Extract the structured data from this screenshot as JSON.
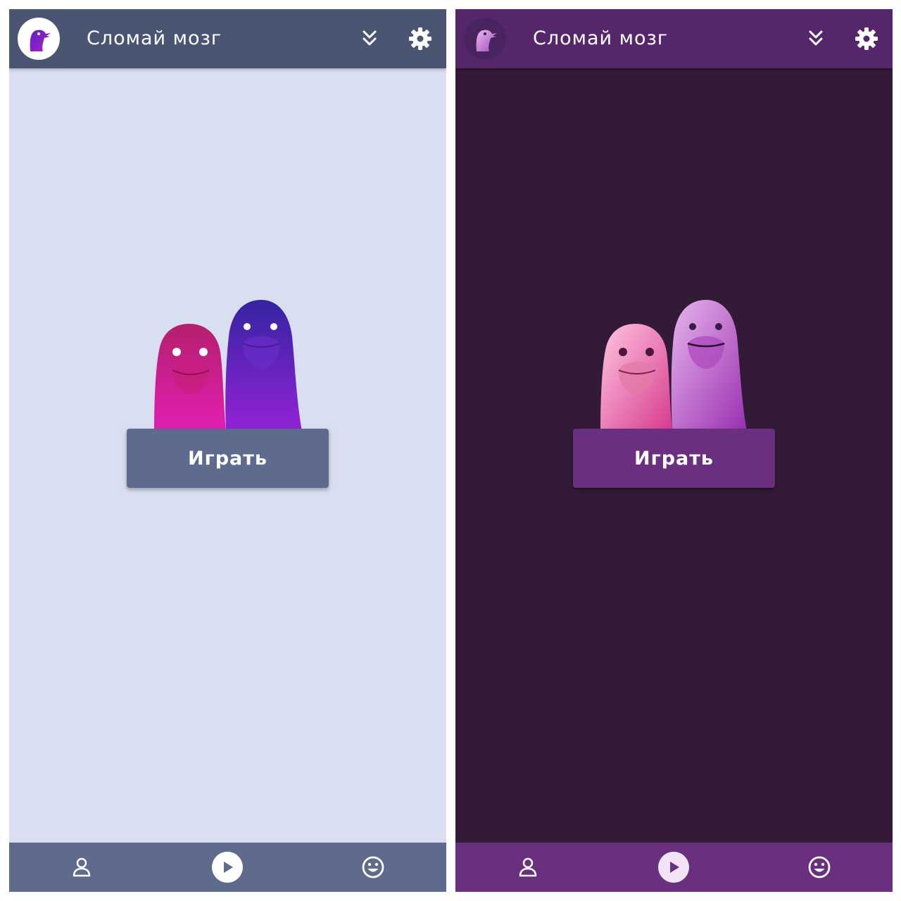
{
  "light": {
    "app_title": "Сломай мозг",
    "play_label": "Играть",
    "icons": {
      "logo": "bird-logo-icon",
      "collapse": "double-chevron-down-icon",
      "settings": "gear-icon",
      "profile": "user-icon",
      "play": "play-icon",
      "smile": "smile-icon"
    },
    "colors": {
      "topbar": "#4a5571",
      "background": "#d9dff0",
      "button": "#5f6b8c",
      "bottombar": "#5f6b8c"
    }
  },
  "dark": {
    "app_title": "Сломай мозг",
    "play_label": "Играть",
    "icons": {
      "logo": "bird-logo-icon",
      "collapse": "double-chevron-down-icon",
      "settings": "gear-icon",
      "profile": "user-icon",
      "play": "play-icon",
      "smile": "smile-icon"
    },
    "colors": {
      "topbar": "#55276a",
      "background": "#331b38",
      "button": "#6a2f7e",
      "bottombar": "#6a2f7e"
    }
  }
}
